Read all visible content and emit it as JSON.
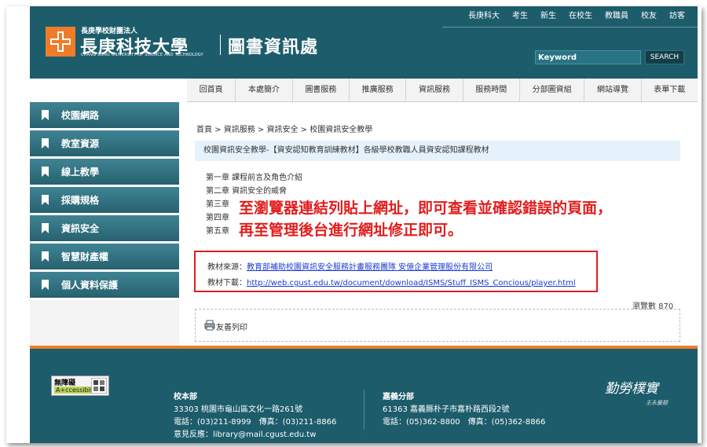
{
  "header": {
    "org": "長庚學校財團法人",
    "school_name": "長庚科技大學",
    "school_name_en": "CHANG GUNG UNIVERSITY OF SCIENCE AND TECHNOLOGY",
    "unit": "圖書資訊處",
    "top_links": [
      "長庚科大",
      "考生",
      "新生",
      "在校生",
      "教職員",
      "校友",
      "訪客"
    ],
    "search": {
      "placeholder": "Keyword",
      "button": "SEARCH"
    }
  },
  "main_nav": [
    "回首頁",
    "本處簡介",
    "圖書服務",
    "推廣服務",
    "資訊服務",
    "服務時間",
    "分部圖資組",
    "網站導覽",
    "表單下載"
  ],
  "sidebar": {
    "items": [
      "校園網路",
      "教室資源",
      "線上教學",
      "採購規格",
      "資訊安全",
      "智慧財產權",
      "個人資料保護"
    ]
  },
  "content": {
    "breadcrumb": "首頁 > 資訊服務 > 資訊安全 > 校園資訊安全教學",
    "title": "校園資訊安全教學-【資安認知教育訓練教材】各級學校教職人員資安認知課程教材",
    "chapters": [
      "第一章 課程前言及角色介紹",
      "第二章 資訊安全的威脅",
      "第三章",
      "第四章",
      "第五章"
    ],
    "source_label": "教材來源：",
    "source_link": "教育部補助校園資訊安全服務計畫服務團隊 安億企業管理股份有限公司",
    "download_label": "教材下載：",
    "download_link": "http://web.cgust.edu.tw/document/download/ISMS/Stuff_ISMS_Concious/player.html",
    "views": "瀏覽數 870",
    "print_label": "友善列印"
  },
  "annotation": {
    "line1": "至瀏覽器連結列貼上網址，即可查看並確認錯誤的頁面，",
    "line2": "再至管理後台進行網址修正即可。"
  },
  "footer": {
    "access_top": "無障礙",
    "access_bottom": "A+ccessibility",
    "main_campus": {
      "name": "校本部",
      "address": "33303 桃園市龜山區文化一路261號",
      "phone": "電話：(03)211-8999　傳真：(03)211-8866",
      "email": "意見反應：library@mail.cgust.edu.tw"
    },
    "chiayi_campus": {
      "name": "嘉義分部",
      "address": "61363 嘉義縣朴子市嘉朴路西段2號",
      "phone": "電話：(05)362-8800　傳真：(05)362-8866"
    },
    "motto": "勤勞樸實",
    "motto_sig": "王永慶題"
  },
  "colors": {
    "header_bg": "#1d5c6b",
    "accent_orange": "#f07c2a",
    "annotation_red": "#e21d1d",
    "link_blue": "#1a3cd6"
  },
  "icons": {
    "sidebar": "bookmark-flag-icon",
    "print": "printer-icon",
    "logo": "cgust-logo-icon",
    "access": "accessibility-icon"
  }
}
